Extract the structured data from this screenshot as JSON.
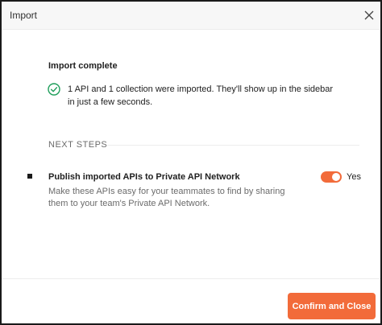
{
  "dialog": {
    "title": "Import",
    "close_icon": "close-icon"
  },
  "import_status": {
    "heading": "Import complete",
    "status_icon": "check-circle-icon",
    "message": "1 API and 1 collection were imported. They'll show up in the sidebar in just a few seconds."
  },
  "next_steps": {
    "label": "NEXT STEPS",
    "items": [
      {
        "title": "Publish imported APIs to Private API Network",
        "description": "Make these APIs easy for your teammates to find by sharing them to your team's Private API Network.",
        "toggle_on": true,
        "toggle_label": "Yes"
      }
    ]
  },
  "footer": {
    "confirm_label": "Confirm and Close"
  },
  "colors": {
    "accent": "#f26b3a",
    "success": "#1e9e5a"
  }
}
